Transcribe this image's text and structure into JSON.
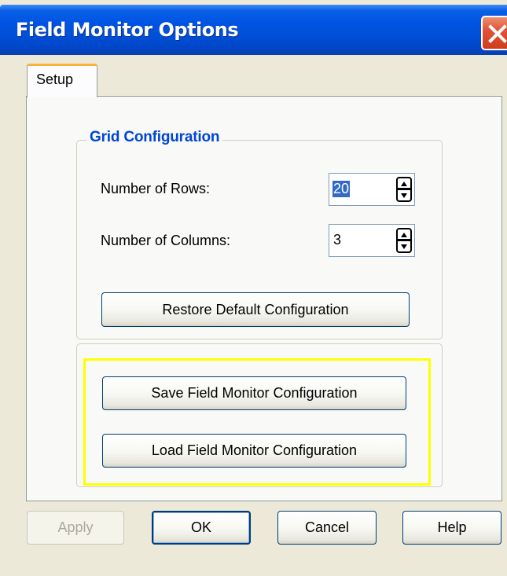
{
  "window": {
    "title": "Field Monitor Options",
    "close_icon": "close-icon"
  },
  "tabs": [
    {
      "label": "Setup",
      "selected": true
    }
  ],
  "grid_config": {
    "group_title": "Grid Configuration",
    "rows_label": "Number of Rows:",
    "rows_value": "20",
    "columns_label": "Number of Columns:",
    "columns_value": "3",
    "restore_button": "Restore Default Configuration"
  },
  "file_actions": {
    "save_button": "Save Field Monitor Configuration",
    "load_button": "Load Field Monitor Configuration"
  },
  "footer": {
    "apply_label": "Apply",
    "apply_enabled": false,
    "ok_label": "OK",
    "cancel_label": "Cancel",
    "help_label": "Help"
  },
  "colors": {
    "titlebar": "#0054e3",
    "group_title": "#0046d5",
    "highlight": "#ffff00",
    "close_button": "#e0543a"
  }
}
